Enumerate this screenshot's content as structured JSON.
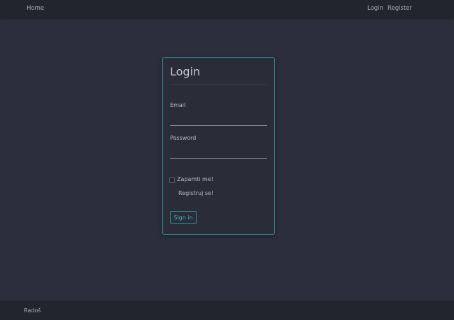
{
  "navbar": {
    "home_label": "Home",
    "login_label": "Login",
    "register_label": "Register"
  },
  "login_card": {
    "title": "Login",
    "email_label": "Email",
    "email_value": "",
    "password_label": "Password",
    "password_value": "",
    "remember_label": "Zapamti me!",
    "remember_checked": false,
    "register_link": "Registruj se!",
    "signin_label": "Sign in"
  },
  "footer": {
    "text": "Radoš"
  },
  "colors": {
    "background": "#2c2f3b",
    "bar": "#22252d",
    "accent": "#2f8a93",
    "accent_text": "#3fb0ba"
  }
}
